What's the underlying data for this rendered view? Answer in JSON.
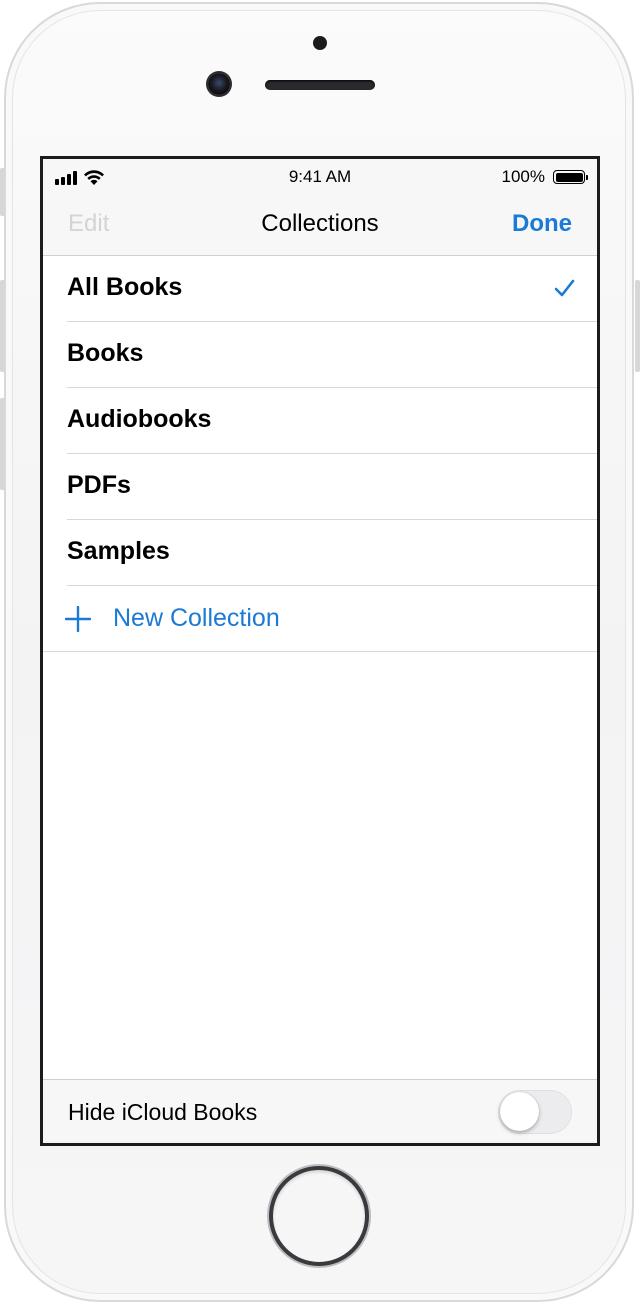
{
  "status_bar": {
    "time": "9:41 AM",
    "battery_percent": "100%",
    "battery_level": 1.0,
    "signal_bars": 4
  },
  "nav": {
    "edit_label": "Edit",
    "title": "Collections",
    "done_label": "Done"
  },
  "collections": {
    "items": [
      {
        "label": "All Books",
        "selected": true
      },
      {
        "label": "Books",
        "selected": false
      },
      {
        "label": "Audiobooks",
        "selected": false
      },
      {
        "label": "PDFs",
        "selected": false
      },
      {
        "label": "Samples",
        "selected": false
      }
    ],
    "new_collection_label": "New Collection"
  },
  "footer": {
    "hide_icloud_label": "Hide iCloud Books",
    "hide_icloud_on": false
  },
  "colors": {
    "accent": "#1a7ad6",
    "disabled": "#d4d4d6",
    "bar_background": "#f7f7f7",
    "separator": "#d8d8dc"
  },
  "icons": {
    "selected": "checkmark-icon",
    "add": "plus-icon",
    "signal": "cellular-signal-icon",
    "wifi": "wifi-icon",
    "battery": "battery-icon"
  }
}
